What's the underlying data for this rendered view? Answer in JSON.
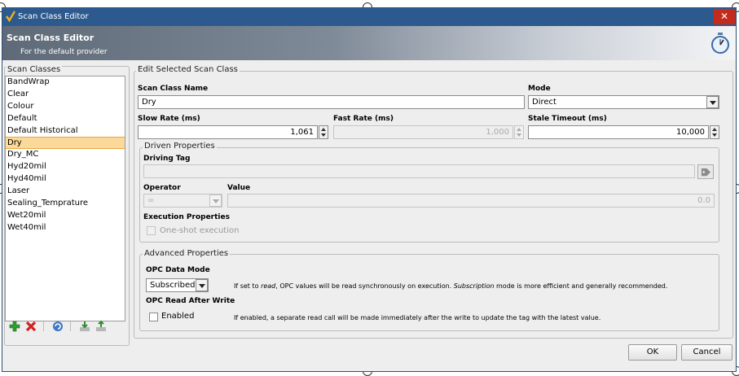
{
  "window": {
    "title": "Scan Class Editor"
  },
  "banner": {
    "title": "Scan Class Editor",
    "subtitle": "For the default provider"
  },
  "scan_classes": {
    "label": "Scan Classes",
    "items": [
      "BandWrap",
      "Clear",
      "Colour",
      "Default",
      "Default Historical",
      "Dry",
      "Dry_MC",
      "Hyd20mil",
      "Hyd40mil",
      "Laser",
      "Sealing_Temprature",
      "Wet20mil",
      "Wet40mil"
    ],
    "selected": "Dry"
  },
  "edit": {
    "label": "Edit Selected Scan Class",
    "name_label": "Scan Class Name",
    "name_value": "Dry",
    "mode_label": "Mode",
    "mode_value": "Direct",
    "slow_label": "Slow Rate (ms)",
    "slow_value": "1,061",
    "fast_label": "Fast Rate (ms)",
    "fast_value": "1,000",
    "stale_label": "Stale Timeout (ms)",
    "stale_value": "10,000"
  },
  "driven": {
    "label": "Driven Properties",
    "driving_tag_label": "Driving Tag",
    "driving_tag_value": "",
    "operator_label": "Operator",
    "operator_value": "=",
    "value_label": "Value",
    "value_value": "0.0",
    "exec_label": "Execution Properties",
    "oneshot_label": "One-shot execution"
  },
  "advanced": {
    "label": "Advanced Properties",
    "opc_mode_label": "OPC Data Mode",
    "opc_mode_value": "Subscribed",
    "opc_mode_help": {
      "p1": "If set to ",
      "read": "read",
      "p2": ", OPC values will be read synchronously on execution. ",
      "subscription": "Subscription",
      "p3": " mode is more efficient and generally recommended."
    },
    "read_after_label": "OPC Read After Write",
    "enabled_label": "Enabled",
    "read_after_help": "If enabled, a separate read call will be made immediately after the write to update the tag with the latest value."
  },
  "footer": {
    "ok": "OK",
    "cancel": "Cancel"
  },
  "colors": {
    "titlebar": "#2d5a8e",
    "close": "#c42b1c",
    "selection": "#fbd99a"
  }
}
